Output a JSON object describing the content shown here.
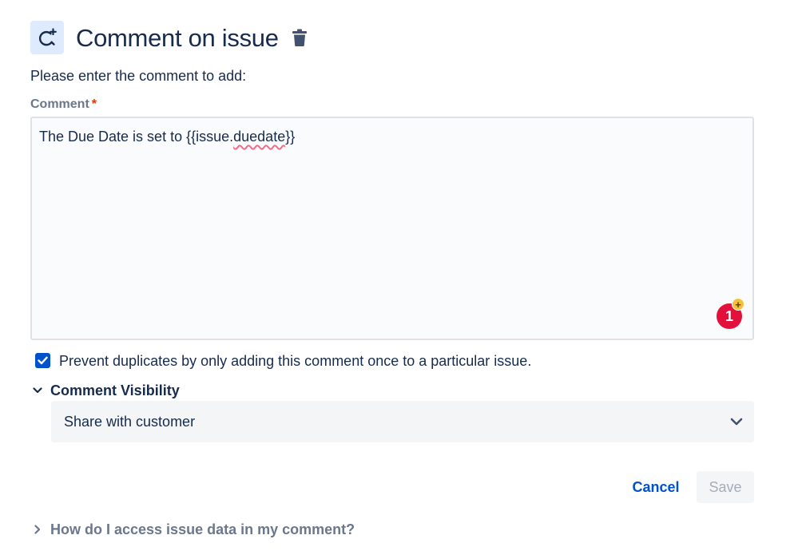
{
  "header": {
    "title": "Comment on issue",
    "action_icon": "comment-add-icon",
    "delete_icon": "trash-icon"
  },
  "form": {
    "instructions": "Please enter the comment to add:",
    "comment_label": "Comment",
    "required_marker": "*",
    "comment_text_before": "The Due Date is set to {{issue.",
    "comment_text_underlined": "duedate",
    "comment_text_after": "}}",
    "extension_badge_count": "1",
    "extension_badge_plus": "+",
    "prevent_duplicates_checked": true,
    "prevent_duplicates_label": "Prevent duplicates by only adding this comment once to a particular issue."
  },
  "visibility": {
    "section_title": "Comment Visibility",
    "expanded": true,
    "selected": "Share with customer"
  },
  "actions": {
    "cancel_label": "Cancel",
    "save_label": "Save"
  },
  "help": {
    "label": "How do I access issue data in my comment?",
    "expanded": false
  },
  "colors": {
    "primary": "#0052cc",
    "text": "#172b4d",
    "subtle_text": "#6b778c",
    "required": "#de350b",
    "badge_red": "#e3103b",
    "badge_yellow": "#f5c13a"
  }
}
